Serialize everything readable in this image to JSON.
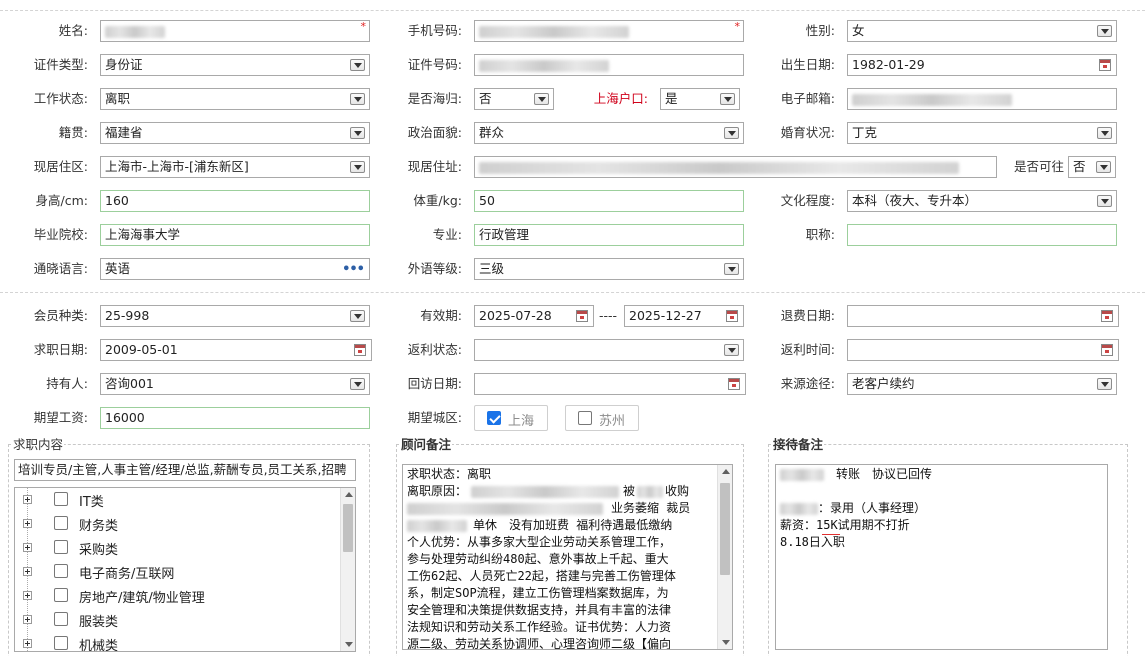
{
  "basic": {
    "name": {
      "label": "姓名:"
    },
    "phone": {
      "label": "手机号码:"
    },
    "gender": {
      "label": "性别:",
      "value": "女"
    },
    "id_type": {
      "label": "证件类型:",
      "value": "身份证"
    },
    "id_number": {
      "label": "证件号码:"
    },
    "birth_date": {
      "label": "出生日期:",
      "value": "1982-01-29"
    },
    "work_status": {
      "label": "工作状态:",
      "value": "离职"
    },
    "returnee": {
      "label": "是否海归:",
      "value": "否"
    },
    "sh_hukou": {
      "label": "上海户口:",
      "value": "是"
    },
    "email": {
      "label": "电子邮箱:"
    },
    "native_place": {
      "label": "籍贯:",
      "value": "福建省"
    },
    "political": {
      "label": "政治面貌:",
      "value": "群众"
    },
    "marital": {
      "label": "婚育状况:",
      "value": "丁克"
    },
    "residence_area": {
      "label": "现居住区:",
      "value": "上海市-上海市-[浦东新区]"
    },
    "address": {
      "label": "现居住址:"
    },
    "can_visit": {
      "label": "是否可往",
      "value": "否"
    },
    "height": {
      "label": "身高/cm:",
      "value": "160"
    },
    "weight": {
      "label": "体重/kg:",
      "value": "50"
    },
    "education": {
      "label": "文化程度:",
      "value": "本科（夜大、专升本）"
    },
    "school": {
      "label": "毕业院校:",
      "value": "上海海事大学"
    },
    "major": {
      "label": "专业:",
      "value": "行政管理"
    },
    "title": {
      "label": "职称:",
      "value": ""
    },
    "language": {
      "label": "通晓语言:",
      "value": "英语"
    },
    "lang_level": {
      "label": "外语等级:",
      "value": "三级"
    }
  },
  "membership": {
    "member_type": {
      "label": "会员种类:",
      "value": "25-998"
    },
    "valid_period": {
      "label": "有效期:",
      "from": "2025-07-28",
      "separator": "----",
      "to": "2025-12-27"
    },
    "refund_date": {
      "label": "退费日期:",
      "value": ""
    },
    "job_seek_date": {
      "label": "求职日期:",
      "value": "2009-05-01"
    },
    "rebate_status": {
      "label": "返利状态:",
      "value": ""
    },
    "rebate_time": {
      "label": "返利时间:",
      "value": ""
    },
    "holder": {
      "label": "持有人:",
      "value": "咨询001"
    },
    "visit_date": {
      "label": "回访日期:",
      "value": ""
    },
    "source": {
      "label": "来源途径:",
      "value": "老客户续约"
    },
    "salary": {
      "label": "期望工资:",
      "value": "16000"
    },
    "cities": {
      "label": "期望城区:",
      "options": [
        {
          "label": "上海",
          "checked": true
        },
        {
          "label": "苏州",
          "checked": false
        }
      ]
    }
  },
  "job_content": {
    "legend": "求职内容",
    "summary": "培训专员/主管,人事主管/经理/总监,薪酬专员,员工关系,招聘",
    "tree": [
      "IT类",
      "财务类",
      "采购类",
      "电子商务/互联网",
      "房地产/建筑/物业管理",
      "服装类",
      "机械类"
    ]
  },
  "consultant_notes": {
    "legend": "顾问备注",
    "lines": [
      "求职状态：离职",
      "离职原因：",
      "被",
      "收购",
      "业务萎缩 裁员",
      "单休　没有加班费 福利待遇最低缴纳",
      "个人优势：从事多家大型企业劳动关系管理工作，",
      "参与处理劳动纠纷480起、意外事故上千起、重大",
      "工伤62起、人员死亡22起，搭建与完善工伤管理体",
      "系，制定SOP流程，建立工伤管理档案数据库，为",
      "安全管理和决策提供数据支持，并具有丰富的法律",
      "法规知识和劳动关系工作经验。证书优势：人力资",
      "源二级、劳动关系协调师、心理咨询师二级【偏向"
    ]
  },
  "reception_notes": {
    "legend": "接待备注",
    "lines": [
      "转账　协议已回传",
      "：录用（人事经理）",
      "薪资：15K试用期不打折",
      "8.18日入职"
    ]
  }
}
